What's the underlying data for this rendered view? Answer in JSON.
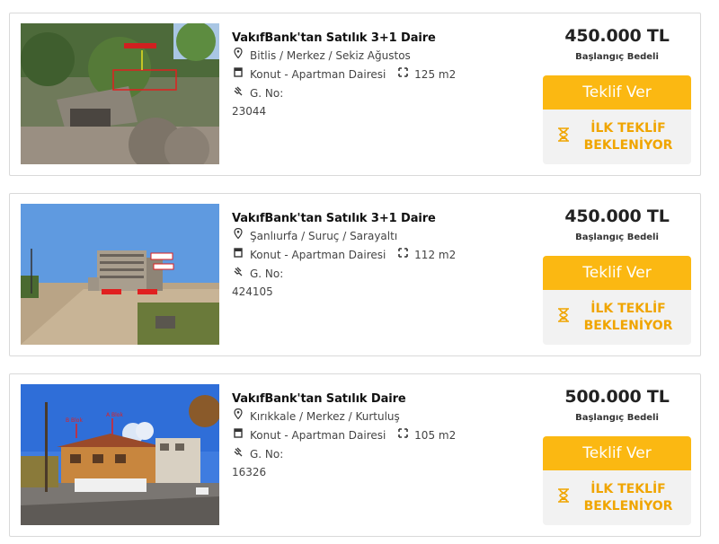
{
  "listings": [
    {
      "title": "VakıfBank'tan Satılık 3+1 Daire",
      "location": "Bitlis / Merkez / Sekiz Ağustos",
      "type": "Konut - Apartman Dairesi",
      "area": "125 m2",
      "gno_label": "G. No:",
      "gno": "23044",
      "price": "450.000 TL",
      "price_label": "Başlangıç Bedeli",
      "offer_button": "Teklif Ver",
      "status_line1": "İLK TEKLİF",
      "status_line2": "BEKLENİYOR"
    },
    {
      "title": "VakıfBank'tan Satılık 3+1 Daire",
      "location": "Şanlıurfa / Suruç / Sarayaltı",
      "type": "Konut - Apartman Dairesi",
      "area": "112 m2",
      "gno_label": "G. No:",
      "gno": "424105",
      "price": "450.000 TL",
      "price_label": "Başlangıç Bedeli",
      "offer_button": "Teklif Ver",
      "status_line1": "İLK TEKLİF",
      "status_line2": "BEKLENİYOR"
    },
    {
      "title": "VakıfBank'tan Satılık Daire",
      "location": "Kırıkkale / Merkez / Kurtuluş",
      "type": "Konut - Apartman Dairesi",
      "area": "105 m2",
      "gno_label": "G. No:",
      "gno": "16326",
      "price": "500.000 TL",
      "price_label": "Başlangıç Bedeli",
      "offer_button": "Teklif Ver",
      "status_line1": "İLK TEKLİF",
      "status_line2": "BEKLENİYOR"
    }
  ],
  "icons": {
    "location": "map-pin-icon",
    "type": "building-icon",
    "area": "area-expand-icon",
    "gno": "hand-icon",
    "status": "hourglass-icon"
  },
  "colors": {
    "accent": "#fbb812",
    "status_text": "#f0a500",
    "status_bg": "#f2f2f2"
  }
}
